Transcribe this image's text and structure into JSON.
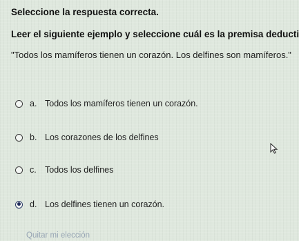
{
  "header": {
    "title": "Seleccione la respuesta correcta."
  },
  "question": {
    "title": "Leer el siguiente ejemplo y seleccione cuál es la premisa deductiva:",
    "text": "\"Todos los mamíferos tienen un corazón. Los delfines son mamíferos.\""
  },
  "options": [
    {
      "letter": "a.",
      "label": "Todos los mamíferos tienen un corazón.",
      "selected": false
    },
    {
      "letter": "b.",
      "label": "Los corazones de los delfines",
      "selected": false
    },
    {
      "letter": "c.",
      "label": "Todos los delfines",
      "selected": false
    },
    {
      "letter": "d.",
      "label": "Los delfines tienen un corazón.",
      "selected": true
    }
  ],
  "footer": {
    "clear_label": "Quitar mi elección"
  },
  "icons": {
    "cursor": "mouse-pointer-icon"
  }
}
